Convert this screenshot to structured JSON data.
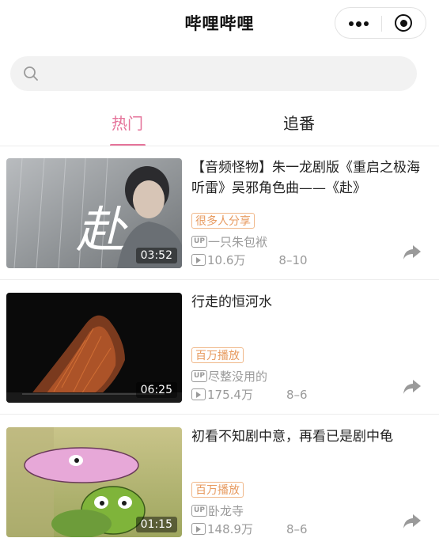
{
  "header": {
    "title": "哔哩哔哩",
    "more_icon": "more-dots-icon",
    "close_icon": "target-close-icon"
  },
  "search": {
    "placeholder": "",
    "icon": "search-icon"
  },
  "tabs": [
    {
      "label": "热门",
      "active": true
    },
    {
      "label": "追番",
      "active": false
    }
  ],
  "colors": {
    "accent": "#e5739a",
    "badge": "#e79a5f",
    "meta": "#9a9a9a"
  },
  "videos": [
    {
      "title": "【音频怪物】朱一龙剧版《重启之极海听雷》吴邪角色曲——《赴》",
      "duration": "03:52",
      "badge": "很多人分享",
      "up_name": "一只朱包袱",
      "views": "10.6万",
      "date": "8–10",
      "thumb_text": "赴"
    },
    {
      "title": "行走的恒河水",
      "duration": "06:25",
      "badge": "百万播放",
      "up_name": "尽整没用的",
      "views": "175.4万",
      "date": "8–6"
    },
    {
      "title": "初看不知剧中意，再看已是剧中龟",
      "duration": "01:15",
      "badge": "百万播放",
      "up_name": "卧龙寺",
      "views": "148.9万",
      "date": "8–6"
    }
  ],
  "labels": {
    "up_tag": "UP"
  }
}
